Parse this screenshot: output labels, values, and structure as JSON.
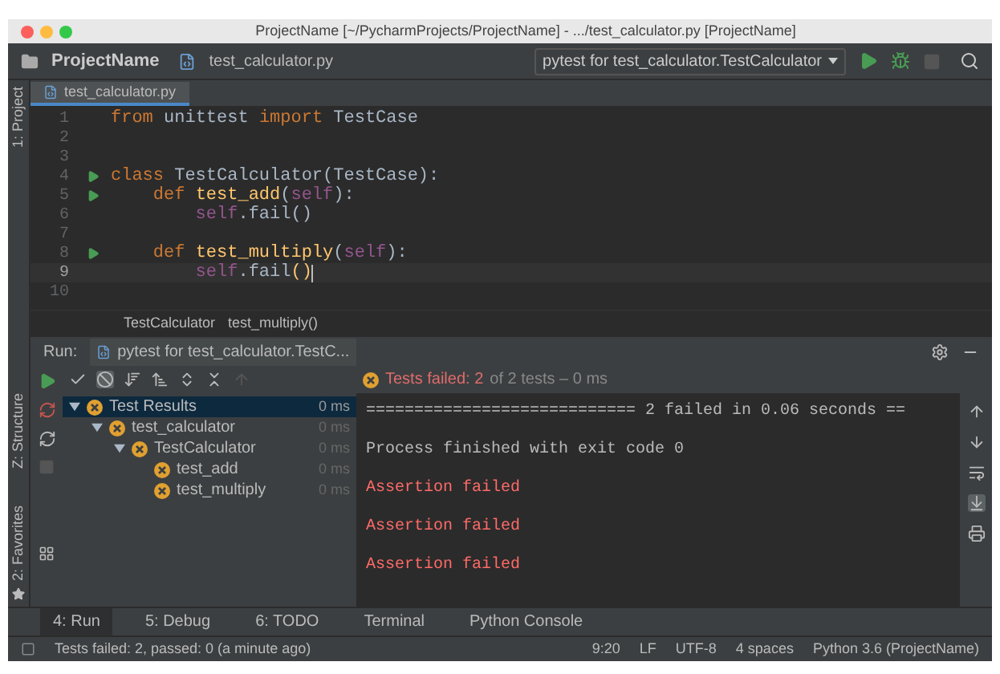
{
  "window": {
    "title": "ProjectName [~/PycharmProjects/ProjectName] - .../test_calculator.py [ProjectName]"
  },
  "toolbar": {
    "project": "ProjectName",
    "file": "test_calculator.py",
    "run_config": "pytest for test_calculator.TestCalculator"
  },
  "side_tabs": [
    {
      "label": "1: Project"
    },
    {
      "label": "Z: Structure"
    },
    {
      "label": "2: Favorites"
    }
  ],
  "editor": {
    "tab": "test_calculator.py",
    "lines": [
      {
        "number": "1",
        "run_marker": false,
        "current": false,
        "tokens": [
          {
            "text": "from ",
            "kind": "keyword"
          },
          {
            "text": "unittest ",
            "kind": "plain"
          },
          {
            "text": "import ",
            "kind": "keyword"
          },
          {
            "text": "TestCase",
            "kind": "plain"
          }
        ]
      },
      {
        "number": "2",
        "run_marker": false,
        "current": false
      },
      {
        "number": "3",
        "run_marker": false,
        "current": false
      },
      {
        "number": "4",
        "run_marker": true,
        "current": false,
        "tokens": [
          {
            "text": "class ",
            "kind": "keyword"
          },
          {
            "text": "TestCalculator(TestCase):",
            "kind": "plain"
          }
        ]
      },
      {
        "number": "5",
        "run_marker": true,
        "current": false,
        "tokens": [
          {
            "text": "    def ",
            "kind": "keyword"
          },
          {
            "text": "test_add",
            "kind": "function"
          },
          {
            "text": "(",
            "kind": "plain"
          },
          {
            "text": "self",
            "kind": "self"
          },
          {
            "text": "):",
            "kind": "plain"
          }
        ]
      },
      {
        "number": "6",
        "run_marker": false,
        "current": false,
        "tokens": [
          {
            "text": "        self",
            "kind": "self"
          },
          {
            "text": ".fail()",
            "kind": "plain"
          }
        ]
      },
      {
        "number": "7",
        "run_marker": false,
        "current": false
      },
      {
        "number": "8",
        "run_marker": true,
        "current": false,
        "tokens": [
          {
            "text": "    def ",
            "kind": "keyword"
          },
          {
            "text": "test_multiply",
            "kind": "function"
          },
          {
            "text": "(",
            "kind": "plain"
          },
          {
            "text": "self",
            "kind": "self"
          },
          {
            "text": "):",
            "kind": "plain"
          }
        ]
      },
      {
        "number": "9",
        "run_marker": false,
        "current": true,
        "tokens": [
          {
            "text": "        self",
            "kind": "self"
          },
          {
            "text": ".fail",
            "kind": "plain"
          },
          {
            "text": "()",
            "kind": "function"
          }
        ]
      },
      {
        "number": "10",
        "run_marker": false,
        "current": false
      }
    ],
    "breadcrumbs": [
      "TestCalculator",
      "test_multiply()"
    ]
  },
  "run_panel": {
    "label": "Run:",
    "tab": "pytest for test_calculator.TestC...",
    "summary_failed": "Tests failed: 2",
    "summary_rest": "of 2 tests – 0 ms",
    "tree": [
      {
        "label": "Test Results",
        "time": "0 ms",
        "selected": true,
        "expanded": true,
        "children": [
          {
            "label": "test_calculator",
            "time": "0 ms",
            "selected": false,
            "expanded": true,
            "children": [
              {
                "label": "TestCalculator",
                "time": "0 ms",
                "selected": false,
                "expanded": true,
                "children": [
                  {
                    "label": "test_add",
                    "time": "0 ms",
                    "selected": false
                  },
                  {
                    "label": "test_multiply",
                    "time": "0 ms",
                    "selected": false
                  }
                ]
              }
            ]
          }
        ]
      }
    ],
    "console": [
      {
        "text": "============================ 2 failed in 0.06 seconds ==",
        "kind": "normal"
      },
      {
        "text": "Process finished with exit code 0",
        "kind": "normal"
      },
      {
        "text": "Assertion failed",
        "kind": "error"
      },
      {
        "text": "Assertion failed",
        "kind": "error"
      },
      {
        "text": "Assertion failed",
        "kind": "error"
      }
    ]
  },
  "tool_tabs": [
    {
      "label": "4: Run",
      "selected": true
    },
    {
      "label": "5: Debug",
      "selected": false
    },
    {
      "label": "6: TODO",
      "selected": false
    },
    {
      "label": "Terminal",
      "selected": false
    },
    {
      "label": "Python Console",
      "selected": false
    }
  ],
  "status_bar": {
    "message": "Tests failed: 2, passed: 0 (a minute ago)",
    "items": [
      "9:20",
      "LF",
      "UTF-8",
      "4 spaces",
      "Python 3.6 (ProjectName)"
    ]
  }
}
